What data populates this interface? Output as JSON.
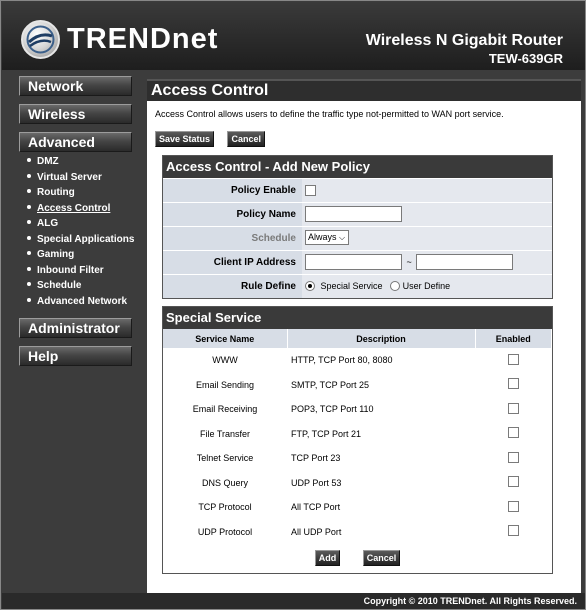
{
  "header": {
    "logo_text": "TRENDnet",
    "product_name": "Wireless N Gigabit Router",
    "model": "TEW-639GR"
  },
  "sidebar": {
    "network": "Network",
    "wireless": "Wireless",
    "advanced": "Advanced",
    "administrator": "Administrator",
    "help": "Help",
    "advanced_items": [
      {
        "label": "DMZ"
      },
      {
        "label": "Virtual Server"
      },
      {
        "label": "Routing"
      },
      {
        "label": "Access Control"
      },
      {
        "label": "ALG"
      },
      {
        "label": "Special Applications"
      },
      {
        "label": "Gaming"
      },
      {
        "label": "Inbound Filter"
      },
      {
        "label": "Schedule"
      },
      {
        "label": "Advanced Network"
      }
    ]
  },
  "main": {
    "title": "Access Control",
    "description": "Access Control allows users to define the traffic type not-permitted to WAN port service.",
    "save_status_label": "Save Status",
    "cancel_label": "Cancel"
  },
  "policy": {
    "heading": "Access Control - Add New Policy",
    "policy_enable_label": "Policy Enable",
    "policy_name_label": "Policy Name",
    "policy_name_value": "",
    "schedule_label": "Schedule",
    "schedule_value": "Always",
    "client_ip_label": "Client IP Address",
    "client_ip_start": "",
    "client_ip_end": "",
    "range_sep": "~",
    "rule_define_label": "Rule Define",
    "rule_special": "Special Service",
    "rule_user": "User Define"
  },
  "special": {
    "heading": "Special Service",
    "col_name": "Service Name",
    "col_desc": "Description",
    "col_enabled": "Enabled",
    "rows": [
      {
        "name": "WWW",
        "desc": "HTTP, TCP Port 80, 8080"
      },
      {
        "name": "Email Sending",
        "desc": "SMTP, TCP Port 25"
      },
      {
        "name": "Email Receiving",
        "desc": "POP3, TCP Port 110"
      },
      {
        "name": "File Transfer",
        "desc": "FTP, TCP Port 21"
      },
      {
        "name": "Telnet Service",
        "desc": "TCP Port 23"
      },
      {
        "name": "DNS Query",
        "desc": "UDP Port 53"
      },
      {
        "name": "TCP Protocol",
        "desc": "All TCP Port"
      },
      {
        "name": "UDP Protocol",
        "desc": "All UDP Port"
      }
    ],
    "add_label": "Add",
    "cancel_label": "Cancel"
  },
  "footer": {
    "copyright": "Copyright © 2010 TRENDnet. All Rights Reserved."
  }
}
